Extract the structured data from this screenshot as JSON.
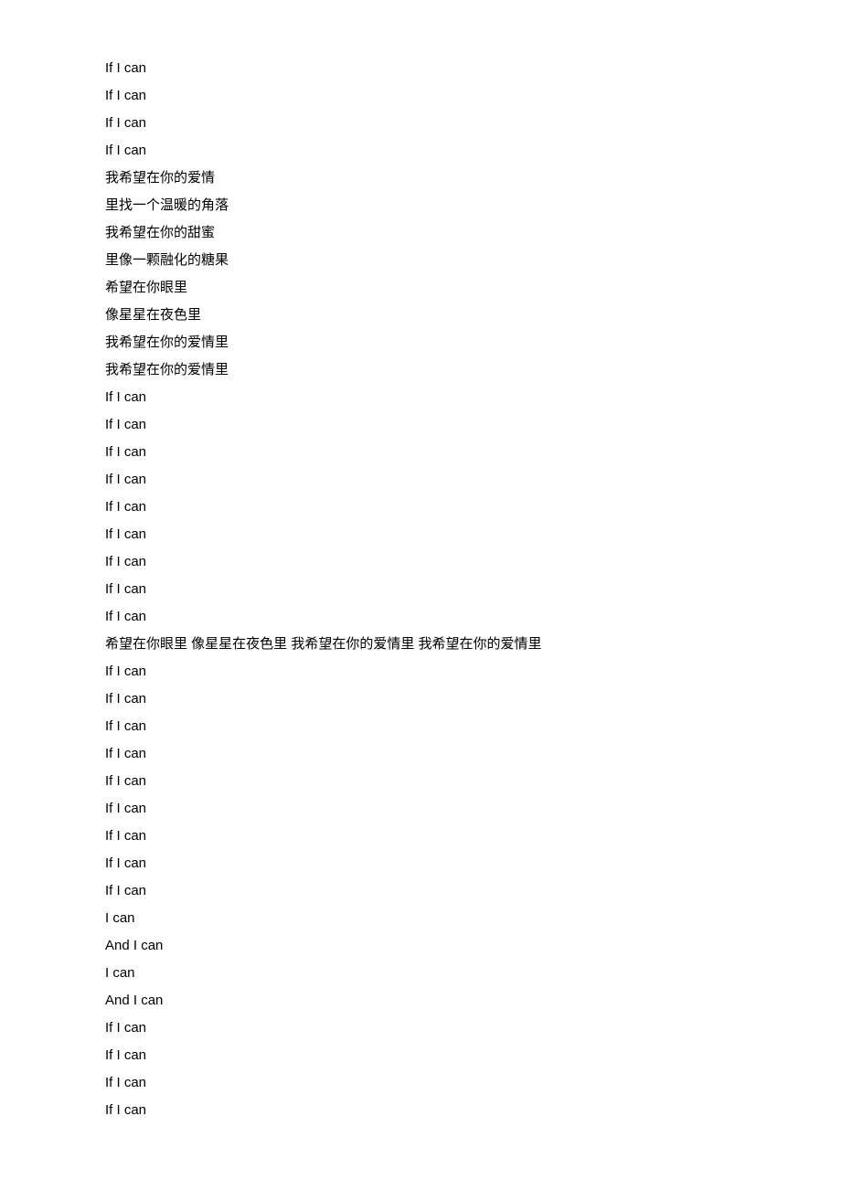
{
  "lines": [
    "If I can",
    "If I can",
    "If I can",
    "If I can",
    "我希望在你的爱情",
    "里找一个温暖的角落",
    "我希望在你的甜蜜",
    "里像一颗融化的糖果",
    "希望在你眼里",
    "像星星在夜色里",
    "我希望在你的爱情里",
    "我希望在你的爱情里",
    "If I can",
    "If I can",
    "If I can",
    "If I can",
    "If I can",
    "If I can",
    "If I can",
    "If I can",
    "If I can",
    "希望在你眼里 像星星在夜色里 我希望在你的爱情里 我希望在你的爱情里",
    "If I can",
    "If I can",
    "If I can",
    "If I can",
    "If I can",
    "If I can",
    "If I can",
    "If I can",
    "If I can",
    "I can",
    "And I can",
    "I can",
    "And I can",
    "If I can",
    "If I can",
    "If I can",
    "If I can"
  ]
}
